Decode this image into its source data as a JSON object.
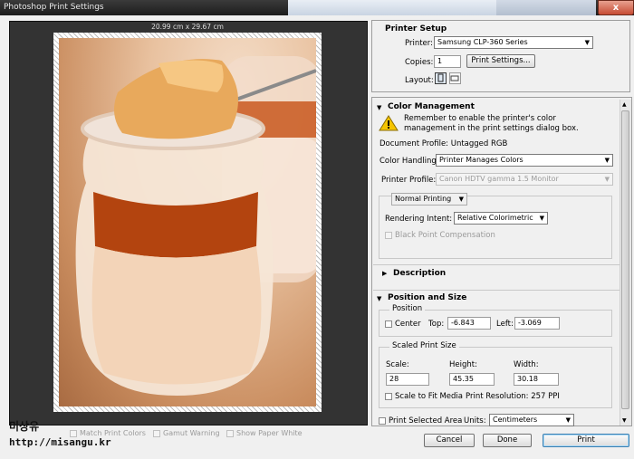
{
  "window": {
    "title": "Photoshop Print Settings",
    "close_glyph": "x"
  },
  "preview": {
    "dimensions": "20.99 cm x 29.67 cm",
    "watermark_name": "미상유",
    "watermark_url": "http://misangu.kr"
  },
  "preview_options": {
    "match_print_colors": "Match Print Colors",
    "gamut_warning": "Gamut Warning",
    "show_paper_white": "Show Paper White"
  },
  "printer_setup": {
    "title": "Printer Setup",
    "printer_label": "Printer:",
    "printer_value": "Samsung CLP-360 Series",
    "copies_label": "Copies:",
    "copies_value": "1",
    "print_settings_button": "Print Settings...",
    "layout_label": "Layout:"
  },
  "color_management": {
    "title": "Color Management",
    "warning": "Remember to enable the printer's color management in the print settings dialog box.",
    "document_profile": "Document Profile: Untagged RGB",
    "color_handling_label": "Color Handling:",
    "color_handling_value": "Printer Manages Colors",
    "printer_profile_label": "Printer Profile:",
    "printer_profile_value": "Canon HDTV gamma 1.5 Monitor",
    "normal_printing": "Normal Printing",
    "rendering_intent_label": "Rendering Intent:",
    "rendering_intent_value": "Relative Colorimetric",
    "black_point": "Black Point Compensation"
  },
  "description": {
    "title": "Description"
  },
  "position_size": {
    "title": "Position and Size",
    "position_group": "Position",
    "center_label": "Center",
    "top_label": "Top:",
    "top_value": "-6.843",
    "left_label": "Left:",
    "left_value": "-3.069",
    "scaled_group": "Scaled Print Size",
    "scale_label": "Scale:",
    "scale_value": "28",
    "height_label": "Height:",
    "height_value": "45.35",
    "width_label": "Width:",
    "width_value": "30.18",
    "scale_to_fit": "Scale to Fit Media",
    "print_resolution": "Print Resolution: 257 PPI",
    "print_selected_area": "Print Selected Area",
    "units_label": "Units:",
    "units_value": "Centimeters"
  },
  "buttons": {
    "cancel": "Cancel",
    "done": "Done",
    "print": "Print"
  },
  "colors": {
    "preview_bg": "#333333",
    "accent": "#3c7fb1",
    "warning": "#f5c400"
  }
}
